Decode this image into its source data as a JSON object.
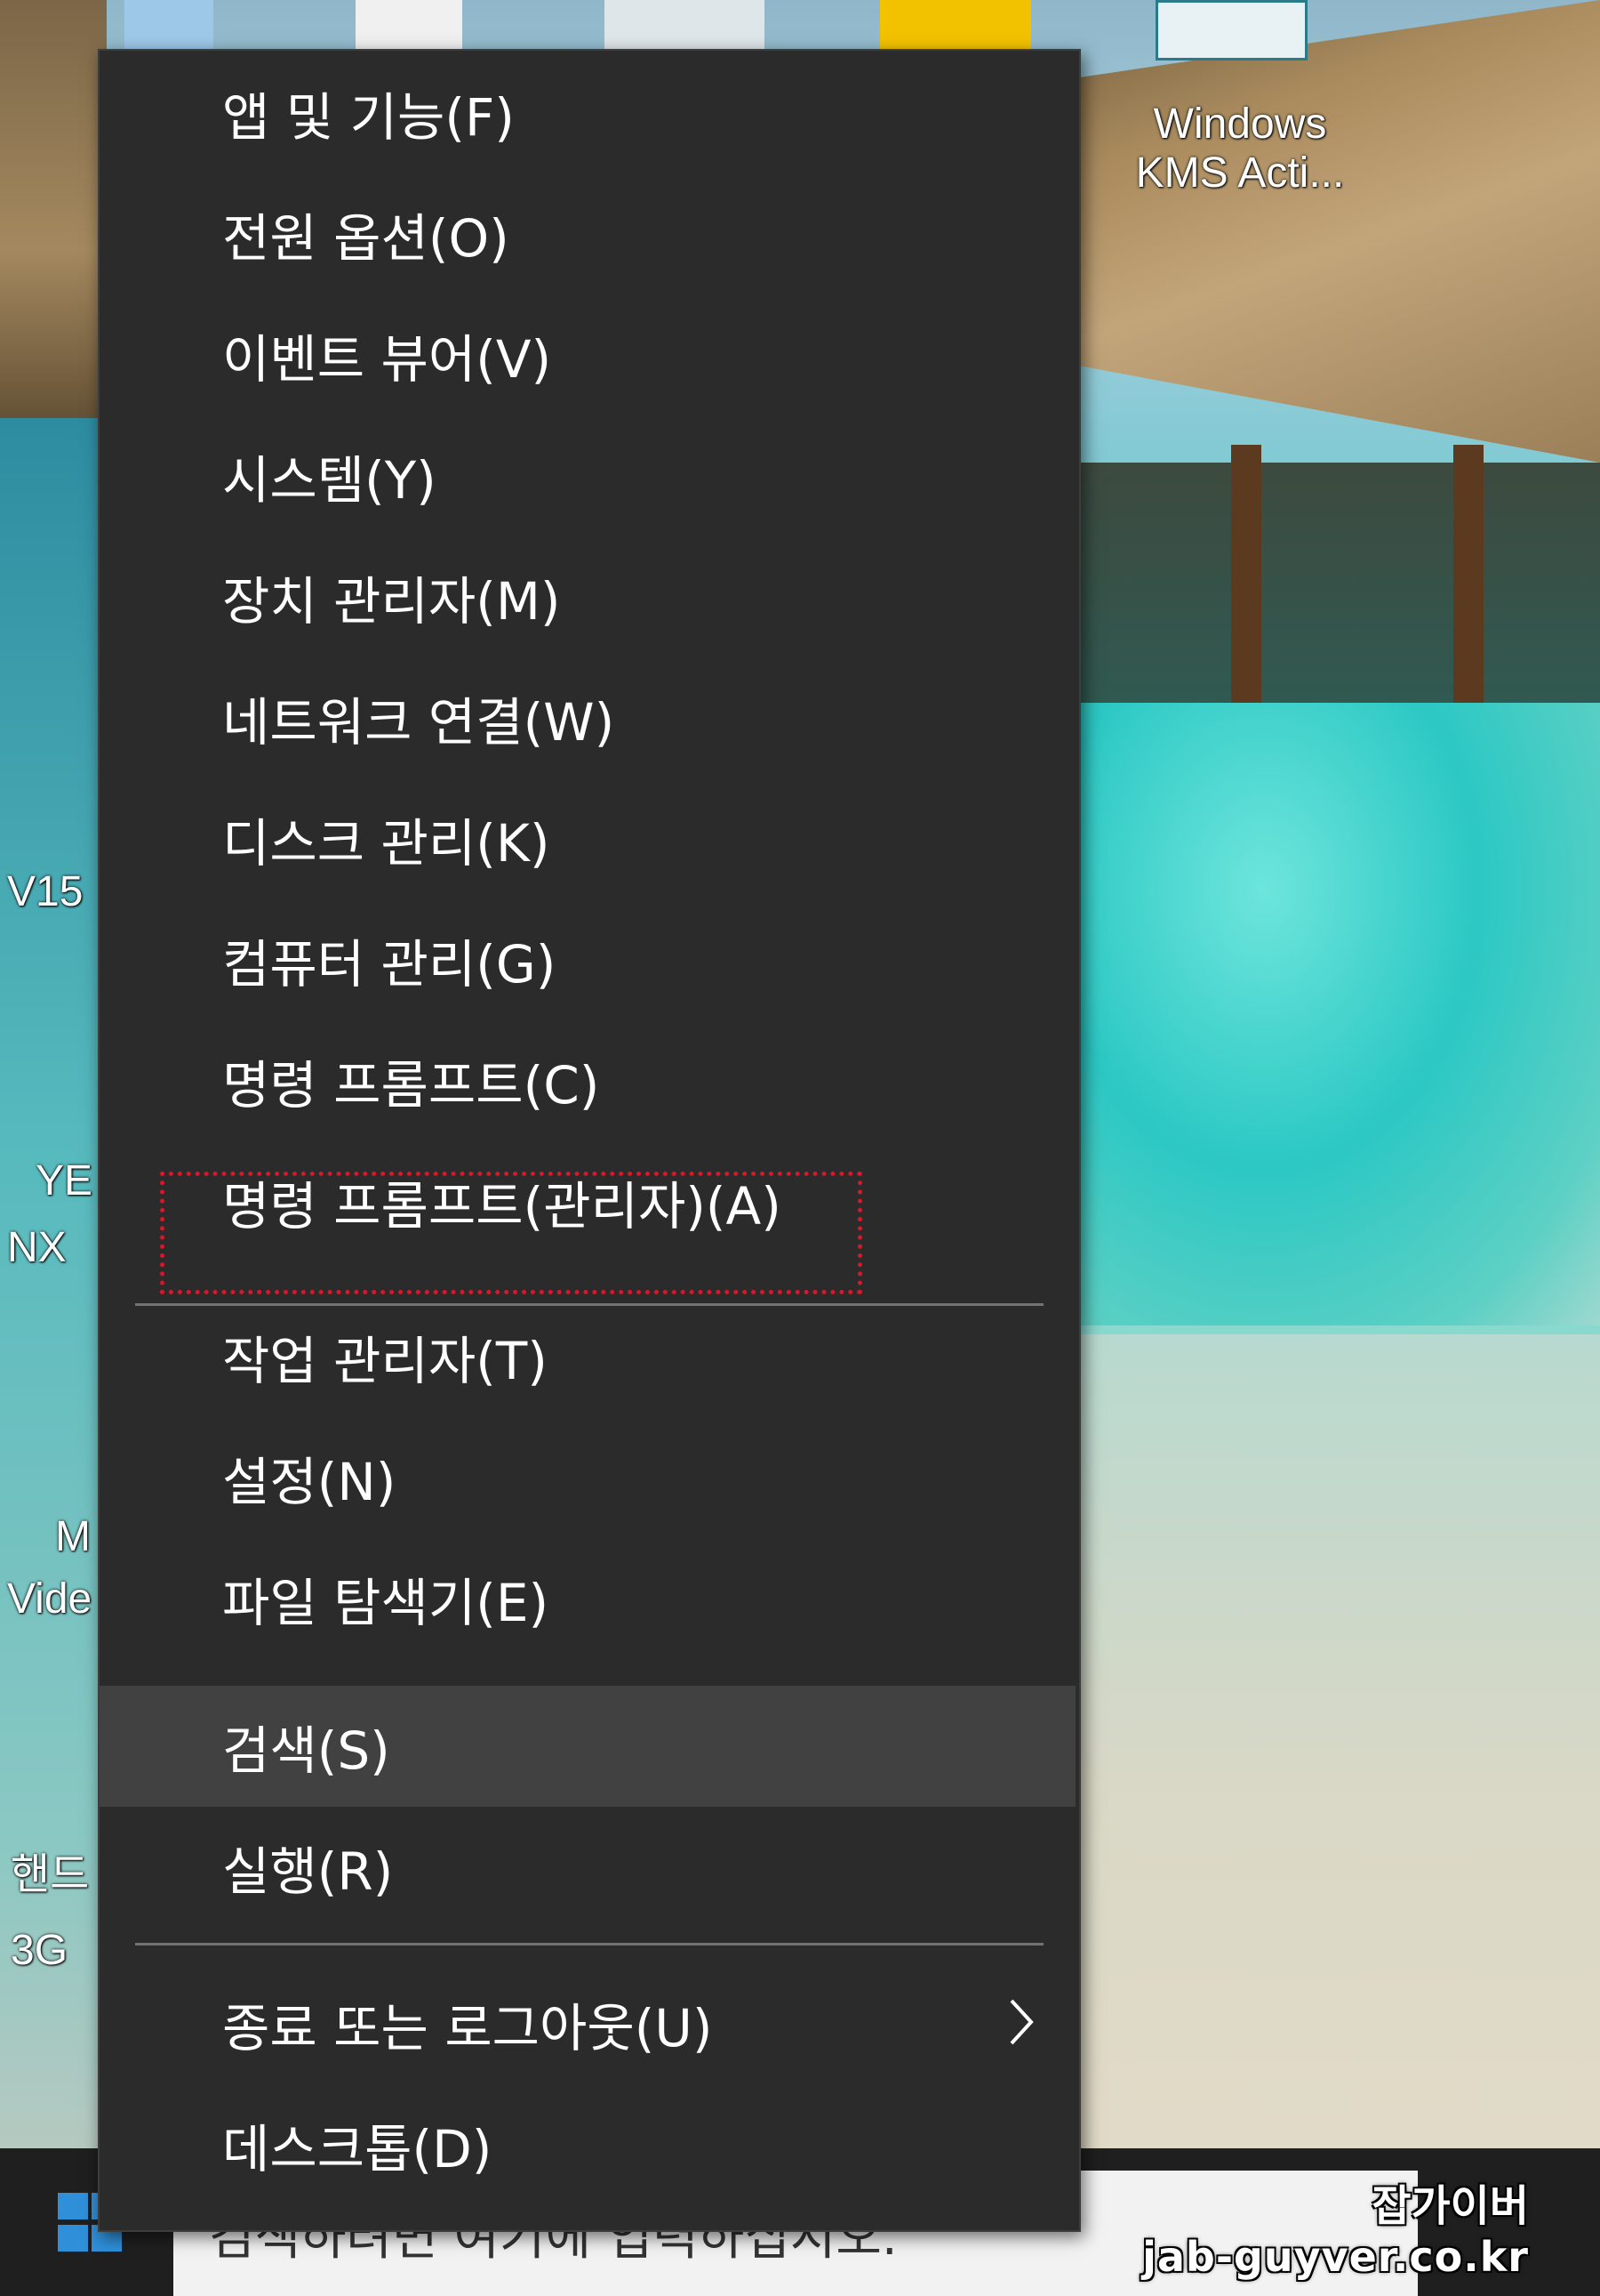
{
  "desktop": {
    "labels": {
      "windows_kms": [
        "Windows",
        "KMS Acti..."
      ],
      "v15": "V15",
      "ye": "YE",
      "nx": "NX",
      "m": "M",
      "video": "Vide",
      "hand": "핸드",
      "three_g": "3G"
    }
  },
  "menu": {
    "items": [
      {
        "label": "앱 및 기능(F)"
      },
      {
        "label": "전원 옵션(O)"
      },
      {
        "label": "이벤트 뷰어(V)"
      },
      {
        "label": "시스템(Y)"
      },
      {
        "label": "장치 관리자(M)"
      },
      {
        "label": "네트워크 연결(W)"
      },
      {
        "label": "디스크 관리(K)"
      },
      {
        "label": "컴퓨터 관리(G)"
      },
      {
        "label": "명령 프롬프트(C)"
      },
      {
        "label": "명령 프롬프트(관리자)(A)"
      },
      {
        "label": "작업 관리자(T)"
      },
      {
        "label": "설정(N)"
      },
      {
        "label": "파일 탐색기(E)"
      },
      {
        "label": "검색(S)"
      },
      {
        "label": "실행(R)"
      },
      {
        "label": "종료 또는 로그아웃(U)"
      },
      {
        "label": "데스크톱(D)"
      }
    ],
    "highlighted_item": "명령 프롬프트(관리자)(A)",
    "hovered_item": "검색(S)",
    "submenu_icon": "chevron-right-icon"
  },
  "taskbar": {
    "search_text": "검색하려면 여기에 입력하십시오."
  },
  "watermark": {
    "line1": "잡가이버",
    "line2": "jab-guyver.co.kr"
  },
  "colors": {
    "menu_bg": "#2b2b2b",
    "menu_hover": "#414141",
    "highlight": "#d8182a",
    "start_blue": "#2f8fd8"
  }
}
